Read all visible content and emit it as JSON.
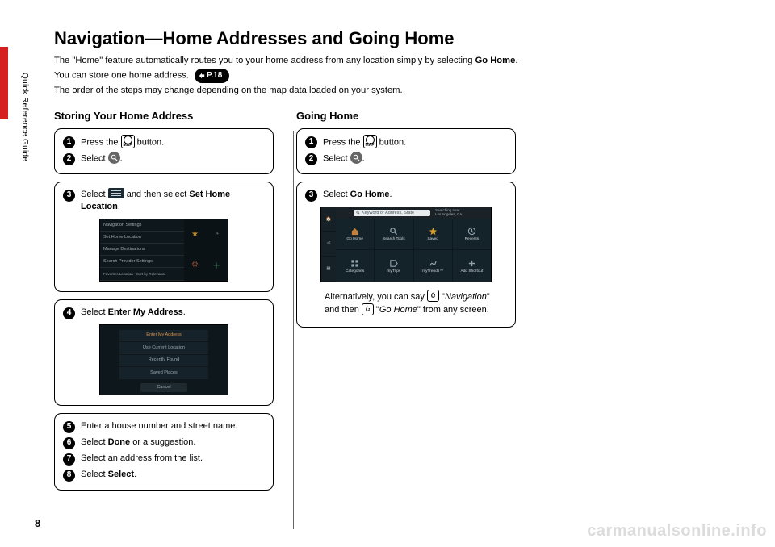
{
  "side_label": "Quick Reference Guide",
  "title": "Navigation—Home Addresses and Going Home",
  "intro1_a": "The \"Home\" feature automatically routes you to your home address from any location simply by selecting ",
  "intro1_b": "Go Home",
  "intro1_c": ".",
  "intro2": "You can store one home address.",
  "page_ref": "P.18",
  "intro3": "The order of the steps may change depending on the map data loaded on your system.",
  "col1": {
    "heading": "Storing Your Home Address",
    "s1a": "Press the ",
    "s1b": " button.",
    "s2a": "Select ",
    "s2b": ".",
    "s3a": "Select ",
    "s3b": " and then select ",
    "s3c": "Set Home Location",
    "s3d": ".",
    "s4a": "Select ",
    "s4b": "Enter My Address",
    "s4c": ".",
    "s5": "Enter a house number and street name.",
    "s6a": "Select ",
    "s6b": "Done",
    "s6c": " or a suggestion.",
    "s7": "Select an address from the list.",
    "s8a": "Select ",
    "s8b": "Select",
    "s8c": "."
  },
  "col2": {
    "heading": "Going Home",
    "s1a": "Press the ",
    "s1b": " button.",
    "s2a": "Select ",
    "s2b": ".",
    "s3a": "Select ",
    "s3b": "Go Home",
    "s3c": ".",
    "alt_a": "Alternatively, you can say ",
    "alt_b": "Navigation",
    "alt_c": " and then ",
    "alt_d": "Go Home",
    "alt_e": " from any screen."
  },
  "shot1": {
    "r1": "Navigation Settings",
    "r2": "Set Home Location",
    "r3": "Manage Destinations",
    "r4": "Search Provider Settings",
    "r5": "Favorites Location • Sort by Relevance"
  },
  "shot2": {
    "o1": "Enter My Address",
    "o2": "Use Current Location",
    "o3": "Recently Found",
    "o4": "Saved Places",
    "cancel": "Cancel"
  },
  "shot3": {
    "search_ph": "Keyword or Address, State",
    "loc1": "Searching near",
    "loc2": "Los Angeles, CA",
    "t1": "Go Home",
    "t2": "Search Tools",
    "t3": "Saved",
    "t4": "Recents",
    "t5": "Categories",
    "t6": "myTrips",
    "t7": "myTrends™",
    "t8": "Add Shortcut"
  },
  "page_num": "8",
  "watermark": "carmanualsonline.info"
}
